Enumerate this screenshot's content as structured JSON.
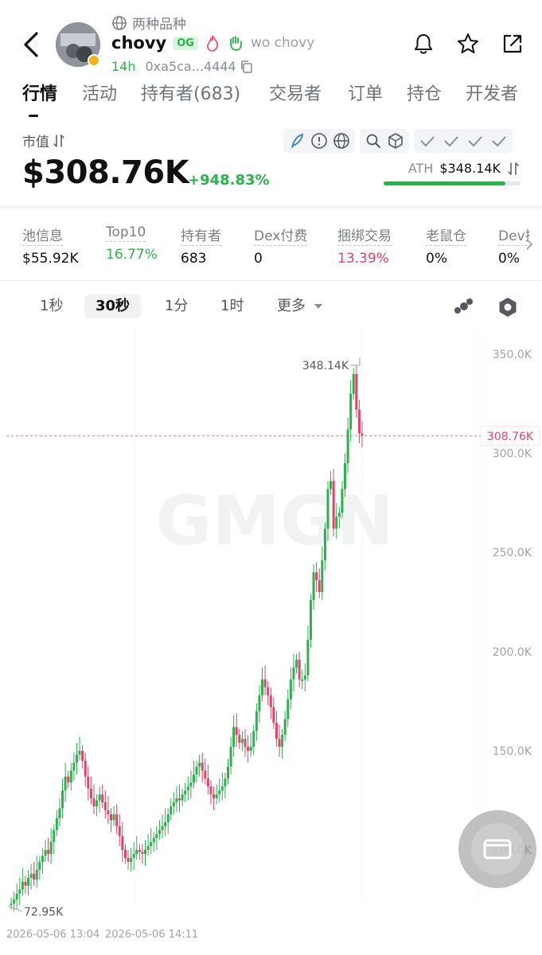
{
  "header": {
    "tag_line": "两种品种",
    "token_name": "chovy",
    "og_badge": "OG",
    "alias": "wo chovy",
    "age": "14h",
    "address": "0xa5ca...4444"
  },
  "tabs": [
    {
      "label": "行情",
      "active": true
    },
    {
      "label": "活动",
      "active": false
    },
    {
      "label": "持有者(683)",
      "active": false
    },
    {
      "label": "交易者",
      "active": false
    },
    {
      "label": "订单",
      "active": false
    },
    {
      "label": "持仓",
      "active": false
    },
    {
      "label": "开发者",
      "active": false
    }
  ],
  "market": {
    "label": "市值",
    "value": "$308.76K",
    "change": "+948.83%",
    "ath_label": "ATH",
    "ath_value": "$348.14K",
    "ath_progress": 0.887
  },
  "stats": [
    {
      "label": "池信息",
      "value": "$55.92K",
      "tone": "normal"
    },
    {
      "label": "Top10",
      "value": "16.77%",
      "tone": "green"
    },
    {
      "label": "持有者",
      "value": "683",
      "tone": "normal"
    },
    {
      "label": "Dex付费",
      "value": "0",
      "tone": "normal"
    },
    {
      "label": "捆绑交易",
      "value": "13.39%",
      "tone": "red"
    },
    {
      "label": "老鼠仓",
      "value": "0%",
      "tone": "normal"
    },
    {
      "label": "Dev持",
      "value": "0%",
      "tone": "normal"
    }
  ],
  "timeframes": {
    "items": [
      "1秒",
      "30秒",
      "1分",
      "1时"
    ],
    "active": "30秒",
    "more": "更多"
  },
  "chart_data": {
    "type": "line",
    "price_axis_ticks": [
      "350.0K",
      "300.0K",
      "250.0K",
      "200.0K",
      "150.0K",
      "100.0K"
    ],
    "price_axis_values": [
      350,
      300,
      250,
      200,
      150,
      100
    ],
    "current_price_label": "308.76K",
    "current_price": 308.76,
    "high_label": "348.14K",
    "high": 348.14,
    "low_label": "72.95K",
    "low": 72.95,
    "x_labels": [
      "2026-05-06 13:04",
      "2026-05-06 14:11"
    ],
    "watermark": "GMGN",
    "ylim": [
      65,
      360
    ],
    "series": [
      {
        "x": [
          0,
          1,
          2,
          3,
          4,
          5,
          6,
          7,
          8,
          9,
          10,
          11,
          12,
          13,
          14,
          15,
          16,
          17,
          18,
          19,
          20,
          21,
          22,
          23,
          24,
          25,
          26,
          27,
          28,
          29,
          30,
          31,
          32,
          33,
          34,
          35,
          36,
          37,
          38,
          39,
          40,
          41,
          42,
          43,
          44,
          45,
          46,
          47,
          48,
          49,
          50,
          51,
          52,
          53,
          54,
          55,
          56,
          57,
          58,
          59,
          60,
          61,
          62,
          63,
          64,
          65,
          66,
          67,
          68,
          69,
          70,
          71,
          72,
          73,
          74,
          75,
          76,
          77,
          78,
          79,
          80,
          81,
          82,
          83,
          84,
          85,
          86,
          87,
          88,
          89,
          90,
          91,
          92,
          93,
          94,
          95,
          96,
          97,
          98,
          99,
          100,
          101,
          102,
          103,
          104,
          105,
          106,
          107,
          108,
          109,
          110,
          111,
          112,
          113,
          114,
          115,
          116,
          117,
          118,
          119,
          120,
          121,
          122,
          123,
          124,
          125,
          126,
          127,
          128,
          129,
          130,
          131,
          132,
          133,
          134,
          135,
          136,
          137,
          138,
          139,
          140,
          141,
          142,
          143,
          144,
          145,
          146,
          147,
          148,
          149
        ],
        "values": [
          73,
          75,
          78,
          80,
          84,
          82,
          86,
          88,
          85,
          90,
          94,
          97,
          100,
          98,
          104,
          110,
          116,
          121,
          130,
          137,
          134,
          140,
          144,
          148,
          150,
          145,
          137,
          131,
          126,
          122,
          125,
          128,
          124,
          120,
          118,
          115,
          118,
          112,
          107,
          100,
          96,
          94,
          96,
          98,
          100,
          99,
          98,
          100,
          102,
          104,
          106,
          108,
          110,
          112,
          114,
          118,
          122,
          124,
          126,
          125,
          128,
          130,
          132,
          134,
          138,
          142,
          144,
          140,
          136,
          132,
          128,
          126,
          128,
          130,
          132,
          136,
          142,
          152,
          162,
          158,
          154,
          156,
          152,
          150,
          152,
          160,
          170,
          178,
          186,
          182,
          178,
          172,
          164,
          156,
          152,
          158,
          166,
          176,
          186,
          192,
          196,
          186,
          186,
          188,
          206,
          226,
          240,
          236,
          230,
          246,
          262,
          282,
          286,
          262,
          268,
          270,
          282,
          295,
          312,
          330,
          340,
          322,
          310,
          309,
          308,
          309,
          308,
          309,
          309,
          309,
          309,
          309,
          309,
          309,
          309,
          309,
          309,
          309,
          309,
          309,
          309,
          309,
          309,
          309,
          309,
          309,
          309,
          309,
          309,
          309
        ]
      }
    ]
  }
}
